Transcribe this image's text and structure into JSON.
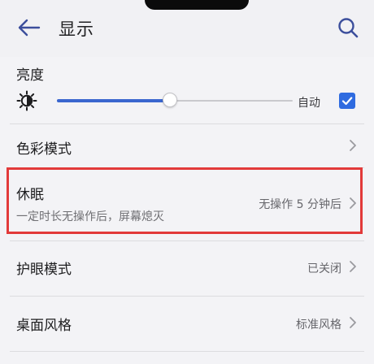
{
  "header": {
    "title": "显示"
  },
  "brightness": {
    "label": "亮度",
    "level": 0.48,
    "auto_label": "自动",
    "auto_checked": true
  },
  "settings": {
    "color_mode": {
      "label": "色彩模式"
    },
    "sleep": {
      "label": "休眠",
      "description": "一定时长无操作后，屏幕熄灭",
      "value": "无操作 5 分钟后"
    },
    "eye_comfort": {
      "label": "护眼模式",
      "value": "已关闭"
    },
    "home_style": {
      "label": "桌面风格",
      "value": "标准风格"
    }
  },
  "colors": {
    "accent": "#3a66cf",
    "checkbox": "#2f6be0",
    "highlight": "#e23a3a"
  },
  "icons": {
    "back": "arrow-left",
    "search": "magnifier",
    "brightness": "half-sun",
    "chevron": "chevron-right",
    "check": "checkmark"
  }
}
